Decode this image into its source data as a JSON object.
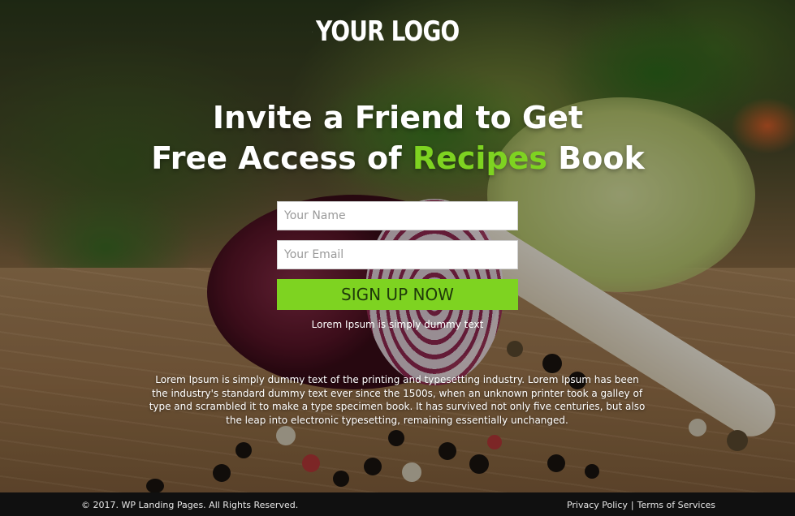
{
  "brand": {
    "logo_text": "YOUR LOGO",
    "logo_icon": "lotus-icon"
  },
  "hero": {
    "headline_line1": "Invite a Friend to Get",
    "headline_line2_prefix": "Free Access of ",
    "headline_line2_accent": "Recipes",
    "headline_line2_suffix": " Book",
    "accent_color": "#7ed321"
  },
  "form": {
    "name_placeholder": "Your Name",
    "name_value": "",
    "email_placeholder": "Your Email",
    "email_value": "",
    "submit_label": "SIGN UP NOW",
    "submit_color": "#7ed321",
    "note": "Lorem Ipsum is simply dummy text"
  },
  "body_text": "Lorem Ipsum is simply dummy text of the printing and typesetting industry. Lorem Ipsum has been the industry's standard dummy text ever since the 1500s, when an unknown printer took a galley of type and scrambled it to make a type specimen book. It has survived not only five centuries, but also the leap into electronic typesetting, remaining essentially unchanged.",
  "footer": {
    "copyright": "© 2017. WP Landing Pages. All Rights Reserved.",
    "links": [
      {
        "label": "Privacy Policy"
      },
      {
        "label": "Terms of Services"
      }
    ],
    "separator": "|"
  }
}
